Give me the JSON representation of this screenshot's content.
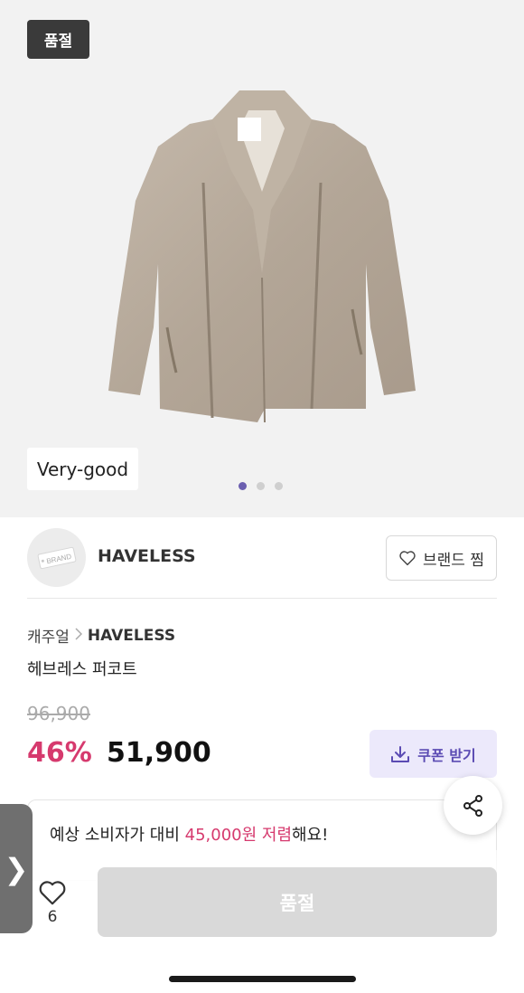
{
  "hero": {
    "status_tag": "품절",
    "condition_tag": "Very-good",
    "image_alt": "fur-coat",
    "dots_total": 3,
    "dot_active": 1
  },
  "brand": {
    "logo_text": "BRAND",
    "name": "HAVELESS",
    "fav_label": "브랜드 찜",
    "fav_icon": "heart-outline-icon"
  },
  "breadcrumb": {
    "category": "캐주얼",
    "brand": "HAVELESS"
  },
  "product": {
    "name": "헤브레스 퍼코트",
    "original_price": "96,900",
    "discount": "46%",
    "price": "51,900",
    "coupon_label": "쿠폰 받기"
  },
  "savings": {
    "prefix": "예상 소비자가 대비 ",
    "amount": "45,000원 저렴",
    "suffix": "해요!"
  },
  "bottom": {
    "like_count": "6",
    "buy_label": "품절",
    "handle_glyph": "❯"
  },
  "colors": {
    "accent_pink": "#d63a6e",
    "accent_purple": "#5b4bb3",
    "coupon_bg": "#ece9fb",
    "disabled_btn": "#d9d9d9"
  }
}
